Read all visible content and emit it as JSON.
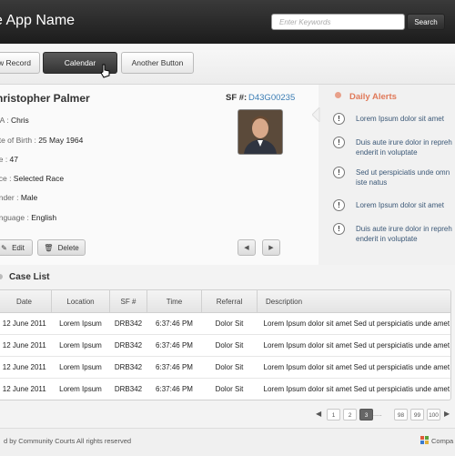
{
  "header": {
    "app_title": "se App Name",
    "search_placeholder": "Enter Keywords",
    "search_button": "Search"
  },
  "toolbar": {
    "buttons": [
      {
        "label": "w Record",
        "active": false
      },
      {
        "label": "Calendar",
        "active": true
      },
      {
        "label": "Another Button",
        "active": false
      }
    ]
  },
  "record": {
    "name": "hristopher Palmer",
    "sf_label": "SF #:",
    "sf_value": "D43G00235",
    "fields": [
      {
        "label": "KA : ",
        "value": "Chris"
      },
      {
        "label": "ate of Birth : ",
        "value": "25 May 1964"
      },
      {
        "label": "ge : ",
        "value": "47"
      },
      {
        "label": "ace : ",
        "value": "Selected Race"
      },
      {
        "label": "ender : ",
        "value": "Male"
      },
      {
        "label": "anguage : ",
        "value": "English"
      }
    ],
    "edit_label": "Edit",
    "delete_label": "Delete"
  },
  "alerts": {
    "title": "Daily Alerts",
    "items": [
      "Lorem Ipsum dolor sit amet",
      "Duis aute irure dolor in repreh enderit in voluptate",
      "Sed ut perspiciatis unde omn iste natus",
      "Lorem Ipsum dolor sit amet",
      "Duis aute irure dolor in repreh enderit in voluptate"
    ]
  },
  "case_list": {
    "title": "Case List",
    "columns": [
      "Date",
      "Location",
      "SF #",
      "Time",
      "Referral",
      "Description"
    ],
    "rows": [
      [
        "12 June 2011",
        "Lorem Ipsum",
        "DRB342",
        "6:37:46 PM",
        "Dolor Sit",
        "Lorem Ipsum dolor sit amet Sed ut perspiciatis unde amet"
      ],
      [
        "12 June 2011",
        "Lorem Ipsum",
        "DRB342",
        "6:37:46 PM",
        "Dolor Sit",
        "Lorem Ipsum dolor sit amet Sed ut perspiciatis unde amet"
      ],
      [
        "12 June 2011",
        "Lorem Ipsum",
        "DRB342",
        "6:37:46 PM",
        "Dolor Sit",
        "Lorem Ipsum dolor sit amet Sed ut perspiciatis unde amet"
      ],
      [
        "12 June 2011",
        "Lorem Ipsum",
        "DRB342",
        "6:37:46 PM",
        "Dolor Sit",
        "Lorem Ipsum dolor sit amet Sed ut perspiciatis unde amet"
      ]
    ]
  },
  "pagination": {
    "pages": [
      "1",
      "2",
      "3",
      "98",
      "99",
      "100"
    ],
    "ellipsis": ".....",
    "current": "3"
  },
  "footer": {
    "text": "d by Community Courts All rights reserved",
    "logo_text": "Compa"
  },
  "colors": {
    "header_bg": "#2a2a2a",
    "accent": "#e07a5a",
    "link": "#3b7db4"
  }
}
